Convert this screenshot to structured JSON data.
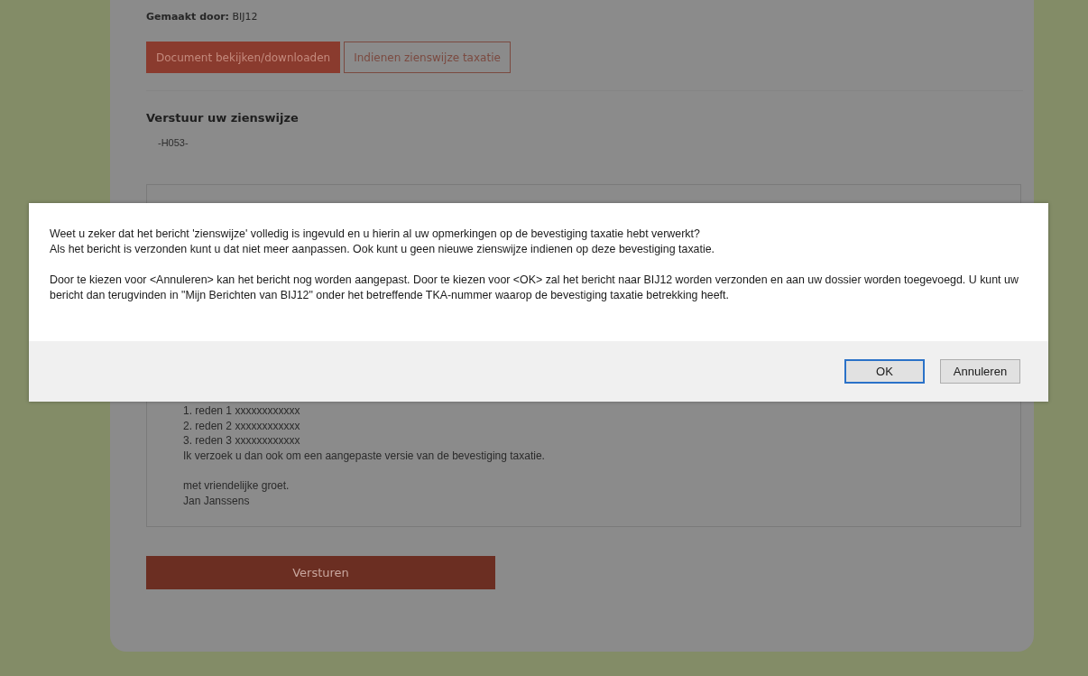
{
  "page": {
    "made_by_label": "Gemaakt door:",
    "made_by_value": "BIJ12",
    "actions": [
      {
        "label": "Document bekijken/downloaden",
        "kind": "filled"
      },
      {
        "label": "Indienen zienswijze taxatie",
        "kind": "outline"
      }
    ],
    "section_title": "Verstuur uw zienswijze",
    "code": "-H053-",
    "message_lines": [
      {
        "text": "1. reden 1 xxxxxxxxxxxx"
      },
      {
        "text": "2. reden 2 xxxxxxxxxxxx"
      },
      {
        "text": "3. reden 3 xxxxxxxxxxxx"
      },
      {
        "text": "Ik verzoek u dan ook om een aangepaste versie van de bevestiging taxatie."
      },
      {
        "text": "met vriendelijke groet."
      },
      {
        "text": "Jan Janssens"
      }
    ],
    "submit": "Versturen"
  },
  "dialog": {
    "paragraphs": [
      [
        "Weet u zeker dat het bericht 'zienswijze' volledig is ingevuld en u hierin al uw opmerkingen op de bevestiging taxatie hebt verwerkt?",
        "Als het bericht is verzonden kunt u dat niet meer aanpassen. Ook kunt u geen nieuwe zienswijze indienen op deze bevestiging taxatie."
      ],
      [
        "Door te kiezen voor <Annuleren> kan het bericht nog worden aangepast. Door te kiezen voor <OK> zal het bericht naar BIJ12 worden verzonden en aan uw dossier worden toegevoegd. U kunt uw bericht dan terugvinden in \"Mijn Berichten van BIJ12\" onder het betreffende TKA-nummer waarop de bevestiging taxatie betrekking heeft."
      ]
    ],
    "buttons": [
      {
        "label": "OK",
        "selected": true
      },
      {
        "label": "Annuleren",
        "selected": false
      }
    ]
  }
}
